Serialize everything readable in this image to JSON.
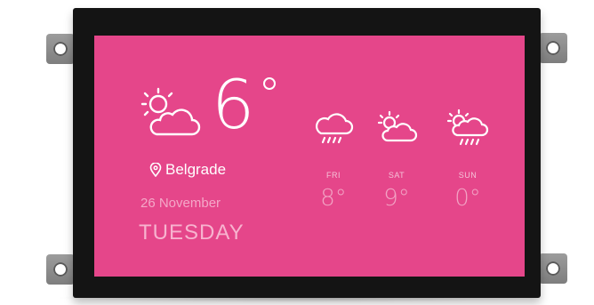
{
  "current": {
    "icon": "partly-cloudy-icon",
    "temperature": "6",
    "degree_symbol": "°",
    "city": "Belgrade",
    "date": "26 November",
    "weekday": "TUESDAY"
  },
  "forecast": [
    {
      "day": "FRI",
      "temp": "8°",
      "icon": "rain-cloud-icon"
    },
    {
      "day": "SAT",
      "temp": "9°",
      "icon": "partly-cloudy-icon"
    },
    {
      "day": "SUN",
      "temp": "0°",
      "icon": "sun-rain-cloud-icon"
    }
  ],
  "colors": {
    "screen": "#e5468a",
    "bezel": "#141414",
    "text_primary": "#ffffff",
    "text_muted": "#f4a8c8"
  }
}
